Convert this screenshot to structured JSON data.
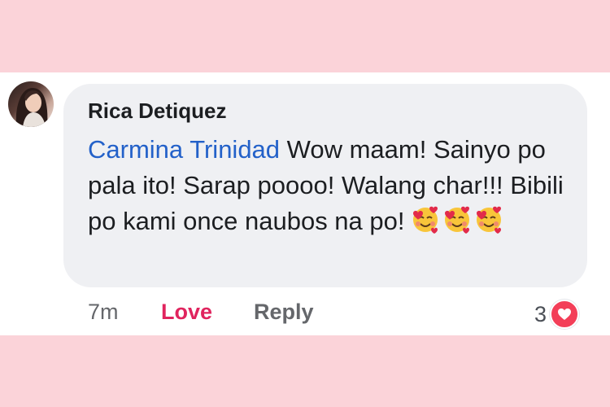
{
  "comment": {
    "author": "Rica Detiquez",
    "mention": "Carmina Trinidad",
    "body": " Wow maam! Sainyo po pala ito! Sarap poooo! Walang char!!! Bibili po kami once naubos na po!",
    "emojis": [
      "smiling-face-with-hearts",
      "smiling-face-with-hearts",
      "smiling-face-with-hearts"
    ],
    "time": "7m",
    "reaction_label": "Love",
    "reply_label": "Reply",
    "reaction_count": "3",
    "reaction_icon": "heart-icon"
  },
  "colors": {
    "background_band": "#fbd3d9",
    "bubble": "#eff0f3",
    "mention": "#2361c9",
    "love": "#e0245e",
    "heart_badge": "#f33e58"
  }
}
